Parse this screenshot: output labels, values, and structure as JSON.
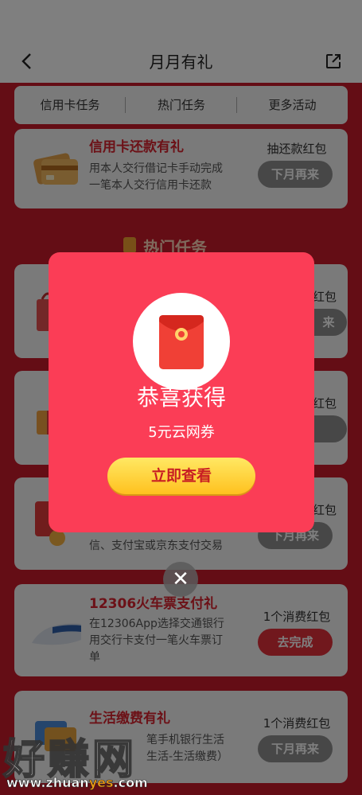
{
  "header": {
    "title": "月月有礼"
  },
  "tabs": [
    "信用卡任务",
    "热门任务",
    "更多活动"
  ],
  "cards": {
    "credit": {
      "title": "信用卡还款有礼",
      "desc1": "用本人交行借记卡手动完成",
      "desc2": "一笔本人交行信用卡还款",
      "reward": "抽还款红包",
      "button": "下月再来"
    },
    "hot_section": "热门任务",
    "card2": {
      "reward": "红包",
      "button": "来"
    },
    "card3": {
      "reward": "红包"
    },
    "card4": {
      "reward": "红包",
      "desc": "信、支付宝或京东支付交易",
      "button": "下月再来"
    },
    "train": {
      "title": "12306火车票支付礼",
      "desc1": "在12306App选择交通银行",
      "desc2": "用交行卡支付一笔火车票订",
      "desc3": "单",
      "reward": "1个消费红包",
      "button": "去完成"
    },
    "life": {
      "title": "生活缴费有礼",
      "desc1": "笔手机银行生活",
      "desc2": "生活-生活缴费）",
      "reward": "1个消费红包",
      "button": "下月再来"
    }
  },
  "modal": {
    "title": "恭喜获得",
    "subtitle": "5元云网券",
    "button": "立即查看"
  },
  "watermark": {
    "big": "好赚网",
    "url_prefix": "www.zhuan",
    "url_highlight": "yes",
    "url_suffix": ".com"
  },
  "colors": {
    "page_red": "#c91a2a",
    "modal_red": "#fb3d56",
    "accent_red": "#d9232f",
    "gold": "#ffc11f"
  }
}
